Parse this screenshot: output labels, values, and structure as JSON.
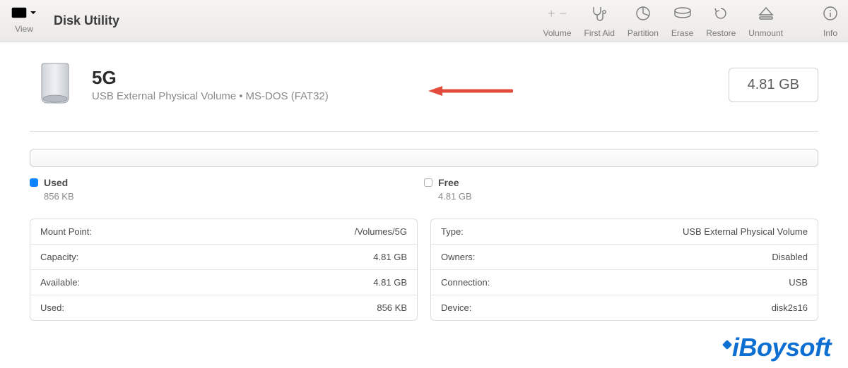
{
  "toolbar": {
    "app_title": "Disk Utility",
    "view_label": "View",
    "items": [
      {
        "id": "volume",
        "label": "Volume",
        "disabled": true
      },
      {
        "id": "firstaid",
        "label": "First Aid",
        "disabled": false
      },
      {
        "id": "partition",
        "label": "Partition",
        "disabled": false
      },
      {
        "id": "erase",
        "label": "Erase",
        "disabled": false
      },
      {
        "id": "restore",
        "label": "Restore",
        "disabled": false
      },
      {
        "id": "unmount",
        "label": "Unmount",
        "disabled": false
      },
      {
        "id": "info",
        "label": "Info",
        "disabled": false
      }
    ]
  },
  "disk": {
    "name": "5G",
    "subtitle_left": "USB External Physical Volume",
    "subtitle_separator": "•",
    "subtitle_right": "MS-DOS (FAT32)",
    "capacity_badge": "4.81 GB"
  },
  "usage": {
    "used": {
      "label": "Used",
      "value": "856 KB"
    },
    "free": {
      "label": "Free",
      "value": "4.81 GB"
    }
  },
  "details_left": [
    {
      "key": "Mount Point:",
      "value": "/Volumes/5G"
    },
    {
      "key": "Capacity:",
      "value": "4.81 GB"
    },
    {
      "key": "Available:",
      "value": "4.81 GB"
    },
    {
      "key": "Used:",
      "value": "856 KB"
    }
  ],
  "details_right": [
    {
      "key": "Type:",
      "value": "USB External Physical Volume"
    },
    {
      "key": "Owners:",
      "value": "Disabled"
    },
    {
      "key": "Connection:",
      "value": "USB"
    },
    {
      "key": "Device:",
      "value": "disk2s16"
    }
  ],
  "watermark": "iBoysoft"
}
